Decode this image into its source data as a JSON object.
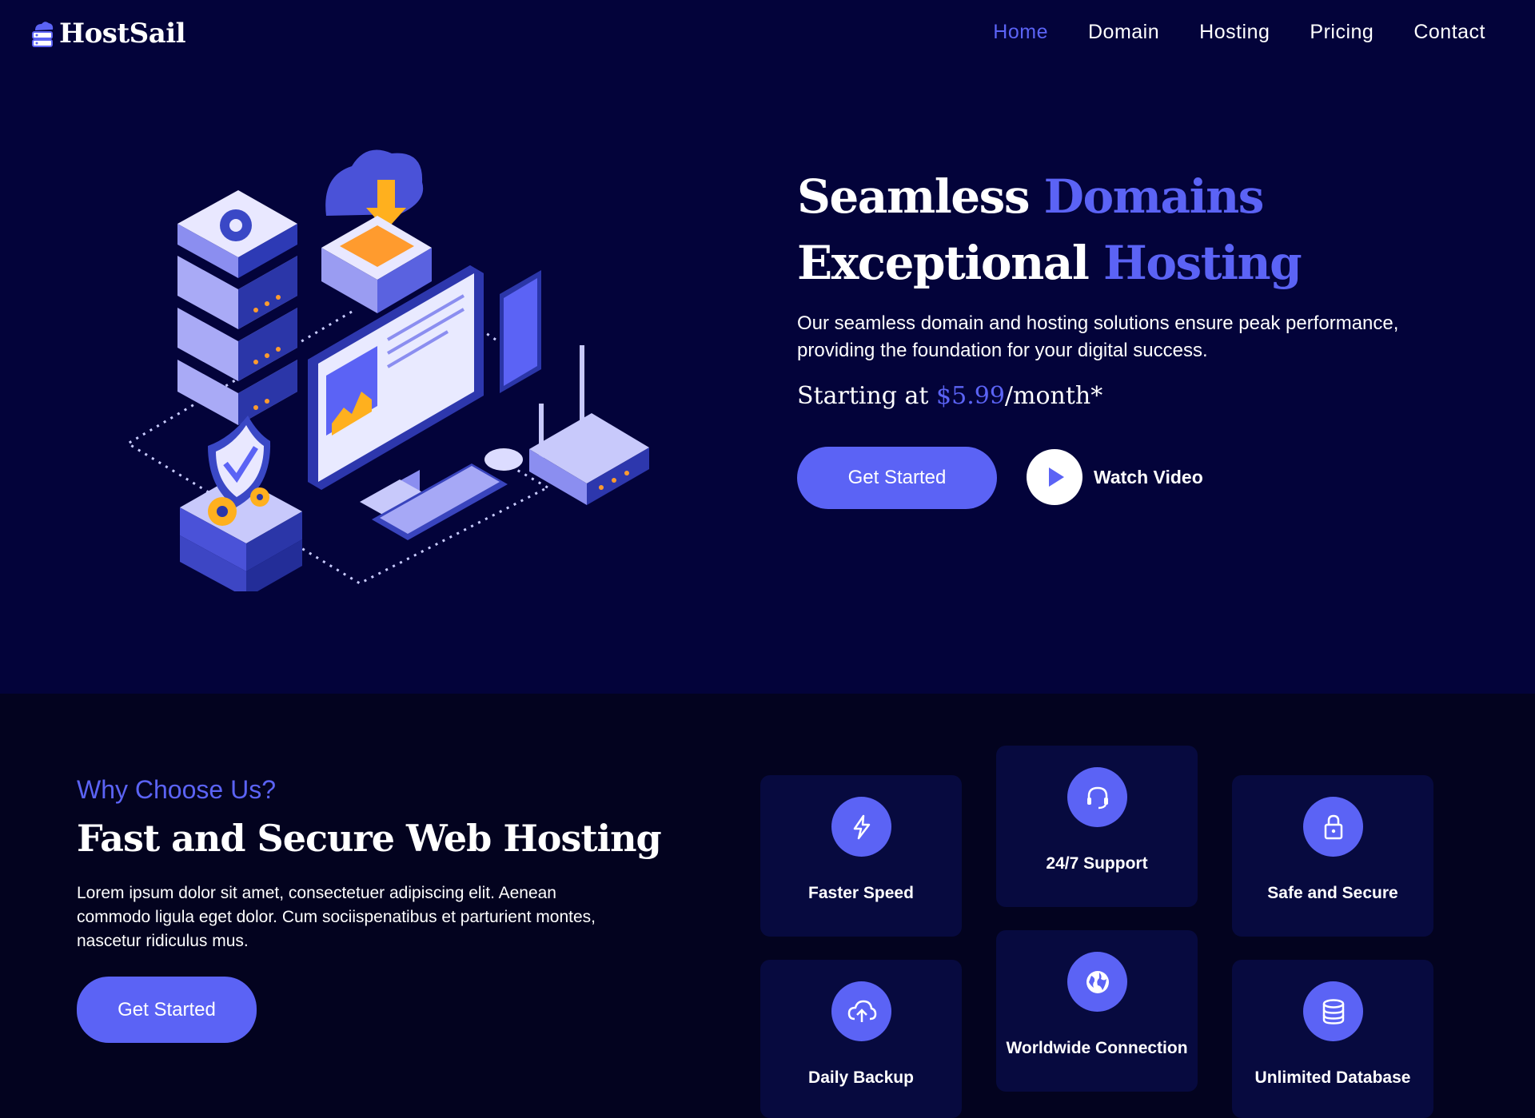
{
  "brand": {
    "name": "HostSail",
    "logo_icon": "cloud-server-icon"
  },
  "nav": {
    "items": [
      {
        "label": "Home",
        "active": true
      },
      {
        "label": "Domain",
        "active": false
      },
      {
        "label": "Hosting",
        "active": false
      },
      {
        "label": "Pricing",
        "active": false
      },
      {
        "label": "Contact",
        "active": false
      }
    ]
  },
  "hero": {
    "title_line1_a": "Seamless ",
    "title_line1_b": "Domains",
    "title_line2_a": "Exceptional ",
    "title_line2_b": "Hosting",
    "description": "Our seamless domain and hosting solutions ensure peak performance, providing the foundation for your digital success.",
    "price_prefix": "Starting at ",
    "price_value": "$5.99",
    "price_suffix": "/month*",
    "cta_label": "Get Started",
    "video_label": "Watch Video"
  },
  "features": {
    "eyebrow": "Why Choose Us?",
    "title": "Fast and Secure Web Hosting",
    "description": "Lorem ipsum dolor sit amet, consectetuer adipiscing elit. Aenean commodo ligula eget dolor. Cum sociispenatibus et parturient montes, nascetur ridiculus mus.",
    "cta_label": "Get Started",
    "cards": [
      {
        "label": "Faster Speed",
        "icon": "lightning-icon"
      },
      {
        "label": "24/7 Support",
        "icon": "headset-icon"
      },
      {
        "label": "Safe and Secure",
        "icon": "lock-icon"
      },
      {
        "label": "Daily Backup",
        "icon": "cloud-upload-icon"
      },
      {
        "label": "Worldwide Connection",
        "icon": "globe-icon"
      },
      {
        "label": "Unlimited Database",
        "icon": "database-icon"
      }
    ]
  },
  "colors": {
    "accent": "#5b63f5",
    "hero_bg": "#03033a",
    "section_bg": "#03031f",
    "card_bg": "#070a3f"
  }
}
